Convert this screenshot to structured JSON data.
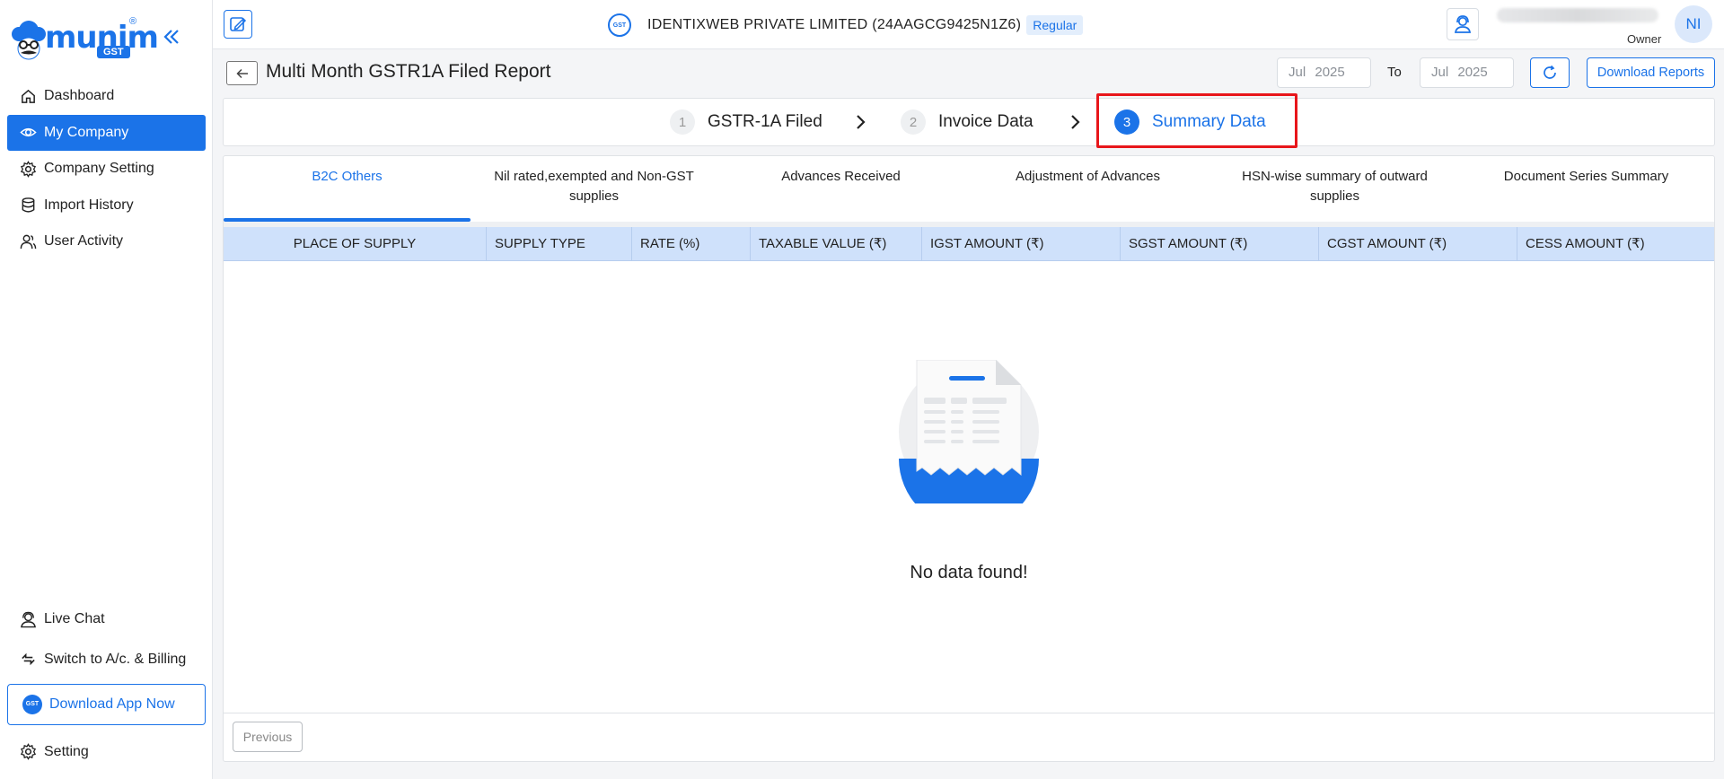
{
  "brand": {
    "name": "munim",
    "badge": "GST",
    "reg": "®"
  },
  "sidebar": {
    "items": [
      {
        "label": "Dashboard",
        "icon": "home-icon"
      },
      {
        "label": "My Company",
        "icon": "eye-icon",
        "active": true
      },
      {
        "label": "Company Setting",
        "icon": "gear-icon"
      },
      {
        "label": "Import History",
        "icon": "database-icon"
      },
      {
        "label": "User Activity",
        "icon": "users-icon"
      }
    ],
    "bottom": {
      "live_chat": "Live Chat",
      "switch": "Switch to A/c. & Billing",
      "download_app": "Download App Now",
      "setting": "Setting"
    }
  },
  "header": {
    "company_name": "IDENTIXWEB PRIVATE LIMITED (24AAGCG9425N1Z6)",
    "company_type": "Regular",
    "user_role": "Owner",
    "avatar_initials": "NI",
    "gst_logo_text": "GST"
  },
  "page": {
    "title": "Multi Month GSTR1A Filed Report",
    "from_month": "Jul",
    "from_year": "2025",
    "to_label": "To",
    "to_month": "Jul",
    "to_year": "2025",
    "download_label": "Download Reports"
  },
  "stepper": {
    "steps": [
      {
        "num": "1",
        "label": "GSTR-1A Filed"
      },
      {
        "num": "2",
        "label": "Invoice Data"
      },
      {
        "num": "3",
        "label": "Summary Data",
        "active": true
      }
    ]
  },
  "tabs": [
    {
      "label": "B2C Others",
      "active": true
    },
    {
      "label": "Nil rated,exempted and Non-GST supplies"
    },
    {
      "label": "Advances Received"
    },
    {
      "label": "Adjustment of Advances"
    },
    {
      "label": "HSN-wise summary of outward supplies"
    },
    {
      "label": "Document Series Summary"
    }
  ],
  "table": {
    "columns": [
      "PLACE OF SUPPLY",
      "SUPPLY TYPE",
      "RATE (%)",
      "TAXABLE VALUE (₹)",
      "IGST AMOUNT (₹)",
      "SGST AMOUNT (₹)",
      "CGST AMOUNT (₹)",
      "CESS AMOUNT (₹)"
    ],
    "empty_text": "No data found!"
  },
  "pagination": {
    "previous": "Previous"
  },
  "colors": {
    "accent": "#1b73e8",
    "highlight": "#e8161b",
    "table_header": "#cfe1fb"
  }
}
